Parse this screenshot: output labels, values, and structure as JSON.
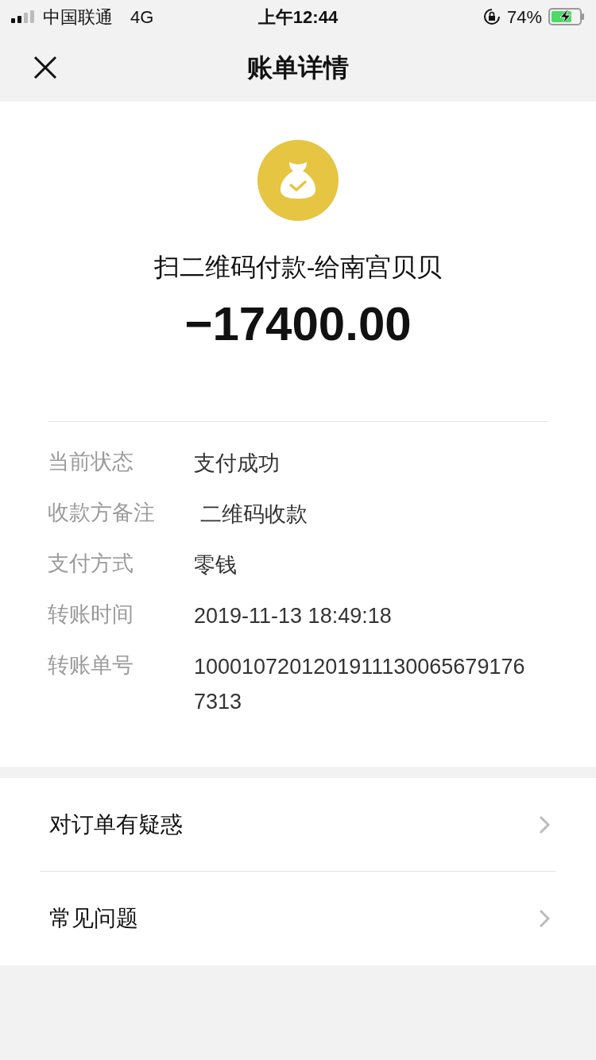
{
  "status_bar": {
    "carrier": "中国联通",
    "network": "4G",
    "time": "上午12:44",
    "battery": "74%",
    "charging": true
  },
  "nav": {
    "title": "账单详情"
  },
  "summary": {
    "title": "扫二维码付款-给南宫贝贝",
    "amount": "−17400.00"
  },
  "details": [
    {
      "label": "当前状态",
      "value": "支付成功"
    },
    {
      "label": "收款方备注",
      "value": " 二维码收款"
    },
    {
      "label": "支付方式",
      "value": "零钱"
    },
    {
      "label": "转账时间",
      "value": "2019-11-13 18:49:18"
    },
    {
      "label": "转账单号",
      "value": "10001072012019111300656791767313"
    }
  ],
  "links": [
    {
      "label": "对订单有疑惑"
    },
    {
      "label": "常见问题"
    }
  ]
}
